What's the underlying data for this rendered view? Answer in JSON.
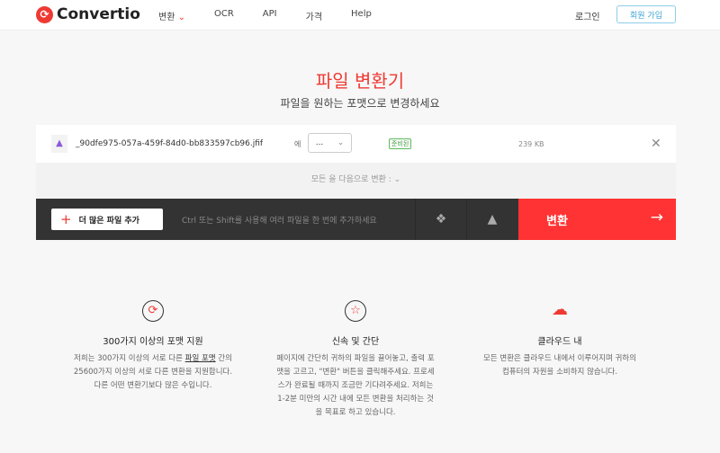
{
  "nav": {
    "brand": "Convertio",
    "items": [
      "변환",
      "OCR",
      "API",
      "가격",
      "Help"
    ],
    "login": "로그인",
    "signup": "회원 가입"
  },
  "hero": {
    "title": "파일 변환기",
    "subtitle": "파일을 원하는 포맷으로 변경하세요"
  },
  "file": {
    "name": "_90dfe975-057a-459f-84d0-bb833597cb96.jfif",
    "to": "에",
    "format": "...",
    "status": "준비된",
    "size": "239 KB"
  },
  "convert_all": "모든 을 다음으로 변환 :",
  "toolbar": {
    "add": "더 많은 파일 추가",
    "hint": "Ctrl 또는 Shift를 사용해 여러 파일을 한 번에 추가하세요",
    "convert": "변환"
  },
  "features": [
    {
      "title": "300가지 이상의 포맷 지원",
      "pre": "저희는 300가지 이상의 서로 다른 ",
      "link": "파일 포맷",
      "post": " 간의 25600가지 이상의 서로 다른 변환을 지원합니다. 다른 어떤 변환기보다 많은 수입니다."
    },
    {
      "title": "신속 및 간단",
      "text": "페이지에 간단히 귀하의 파일을 끌어놓고, 출력 포맷을 고르고, \"변환\" 버튼을 클릭해주세요. 프로세스가 완료될 때까지 조금만 기다려주세요. 저희는 1-2분 미만의 시간 내에 모든 변환을 처리하는 것을 목표로 하고 있습니다."
    },
    {
      "title": "클라우드 내",
      "text": "모든 변환은 클라우드 내에서 이루어지며 귀하의 컴퓨터의 자원을 소비하지 않습니다."
    }
  ]
}
